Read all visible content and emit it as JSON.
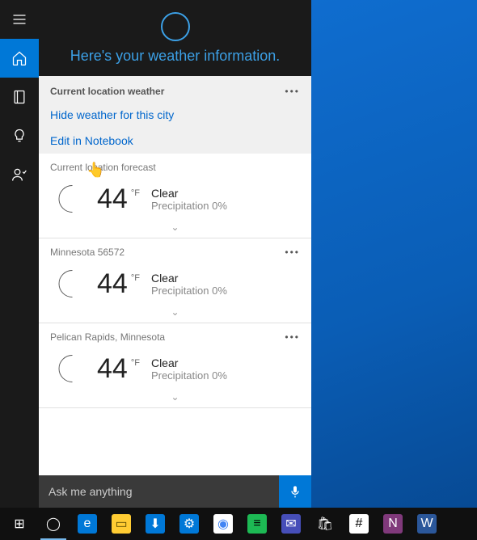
{
  "header": {
    "title": "Here's your weather information."
  },
  "section": {
    "title": "Current location weather",
    "actions": {
      "hide": "Hide weather for this city",
      "edit": "Edit in Notebook"
    }
  },
  "forecasts": [
    {
      "location": "Current location forecast",
      "temp": "44",
      "unit": "°F",
      "condition": "Clear",
      "precip": "Precipitation 0%",
      "show_dots": false
    },
    {
      "location": "Minnesota 56572",
      "temp": "44",
      "unit": "°F",
      "condition": "Clear",
      "precip": "Precipitation 0%",
      "show_dots": true
    },
    {
      "location": "Pelican Rapids, Minnesota",
      "temp": "44",
      "unit": "°F",
      "condition": "Clear",
      "precip": "Precipitation 0%",
      "show_dots": true
    }
  ],
  "search": {
    "placeholder": "Ask me anything"
  },
  "taskbar": {
    "items": [
      {
        "name": "start",
        "bg": "transparent",
        "glyph": "⊞",
        "color": "#fff"
      },
      {
        "name": "cortana",
        "bg": "transparent",
        "glyph": "◯",
        "color": "#fff",
        "active": true
      },
      {
        "name": "edge",
        "bg": "#0078d7",
        "glyph": "e",
        "color": "#fff"
      },
      {
        "name": "file-explorer",
        "bg": "#ffcc33",
        "glyph": "▭",
        "color": "#5a4a00"
      },
      {
        "name": "store",
        "bg": "#0078d7",
        "glyph": "⬇",
        "color": "#fff"
      },
      {
        "name": "settings",
        "bg": "#0078d7",
        "glyph": "⚙",
        "color": "#fff"
      },
      {
        "name": "chrome",
        "bg": "#fff",
        "glyph": "◉",
        "color": "#4285f4"
      },
      {
        "name": "spotify",
        "bg": "#1db954",
        "glyph": "≡",
        "color": "#000"
      },
      {
        "name": "teams",
        "bg": "#464eb8",
        "glyph": "✉",
        "color": "#fff"
      },
      {
        "name": "shopping",
        "bg": "transparent",
        "glyph": "🛍",
        "color": "#fff"
      },
      {
        "name": "slack",
        "bg": "#fff",
        "glyph": "#",
        "color": "#000"
      },
      {
        "name": "onenote",
        "bg": "#80397b",
        "glyph": "N",
        "color": "#fff"
      },
      {
        "name": "word",
        "bg": "#2b579a",
        "glyph": "W",
        "color": "#fff"
      }
    ]
  }
}
